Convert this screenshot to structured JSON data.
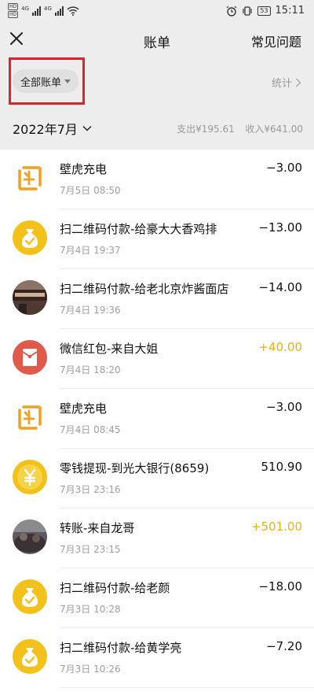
{
  "status": {
    "hd1": "HD",
    "hd2": "HD",
    "net1": "4G",
    "net2": "4G",
    "battery": "53",
    "time": "15:11"
  },
  "header": {
    "title": "账单",
    "faq_label": "常见问题"
  },
  "filter": {
    "label": "全部账单",
    "stats_label": "统计"
  },
  "month": {
    "label": "2022年7月",
    "expense": "支出¥195.61",
    "income": "收入¥641.00"
  },
  "colors": {
    "income_amount": "#e9b20f",
    "header_bg": "#ededed",
    "highlight_border": "#e0202a"
  },
  "transactions": [
    {
      "title": "壁虎充电",
      "time": "7月5日 08:50",
      "amount": "−3.00",
      "type": "expense",
      "icon": "gecko-charge-icon"
    },
    {
      "title": "扫二维码付款-给豪大大香鸡排",
      "time": "7月4日 19:37",
      "amount": "−13.00",
      "type": "expense",
      "icon": "money-bag-icon"
    },
    {
      "title": "扫二维码付款-给老北京炸酱面店",
      "time": "7月4日 19:36",
      "amount": "−14.00",
      "type": "expense",
      "icon": "shop-photo-avatar"
    },
    {
      "title": "微信红包-来自大姐",
      "time": "7月4日 18:20",
      "amount": "+40.00",
      "type": "income",
      "icon": "red-packet-icon"
    },
    {
      "title": "壁虎充电",
      "time": "7月4日 08:45",
      "amount": "−3.00",
      "type": "expense",
      "icon": "gecko-charge-icon"
    },
    {
      "title": "零钱提现-到光大银行(8659)",
      "time": "7月3日 23:16",
      "amount": "510.90",
      "type": "withdraw",
      "icon": "yen-coin-icon"
    },
    {
      "title": "转账-来自龙哥",
      "time": "7月3日 23:15",
      "amount": "+501.00",
      "type": "income",
      "icon": "user-photo-avatar"
    },
    {
      "title": "扫二维码付款-给老颜",
      "time": "7月3日 10:28",
      "amount": "−18.00",
      "type": "expense",
      "icon": "money-bag-icon"
    },
    {
      "title": "扫二维码付款-给黄学亮",
      "time": "7月3日 10:26",
      "amount": "−7.20",
      "type": "expense",
      "icon": "money-bag-icon"
    }
  ]
}
